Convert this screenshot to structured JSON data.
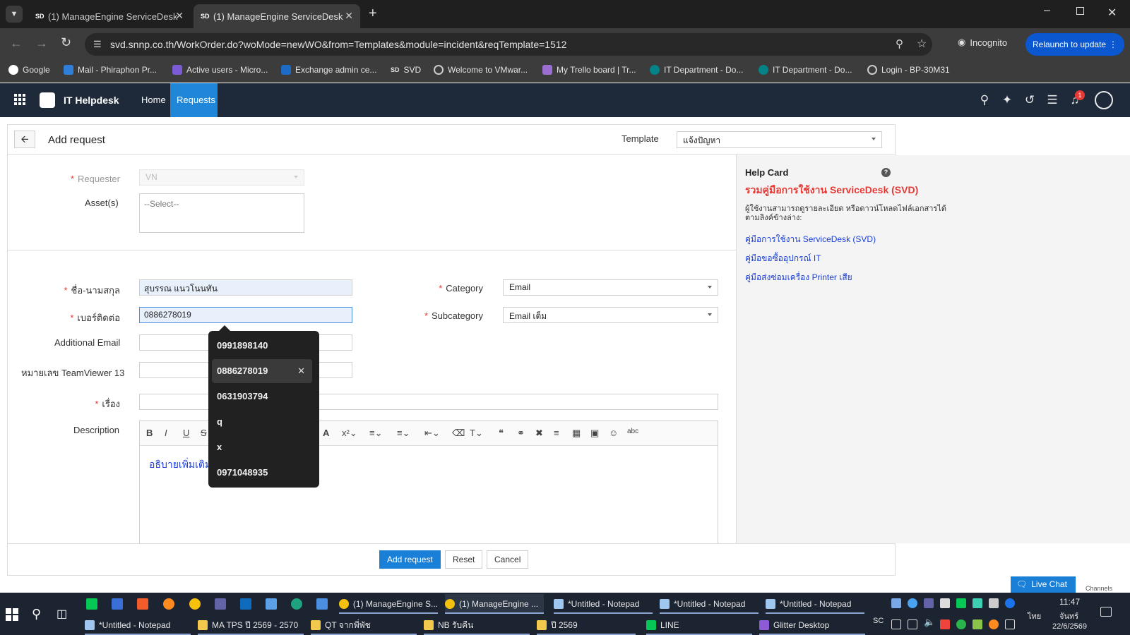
{
  "browser": {
    "tabs": [
      {
        "favicon": "SD",
        "title": "(1) ManageEngine ServiceDesk",
        "active": false
      },
      {
        "favicon": "SD",
        "title": "(1) ManageEngine ServiceDesk",
        "active": true
      }
    ],
    "url": "svd.snnp.co.th/WorkOrder.do?woMode=newWO&from=Templates&module=incident&reqTemplate=1512",
    "incognito_label": "Incognito",
    "relaunch_label": "Relaunch to update",
    "bookmarks": [
      "Google",
      "Mail - Phiraphon Pr...",
      "Active users - Micro...",
      "Exchange admin ce...",
      "SVD",
      "Welcome to VMwar...",
      "My Trello board | Tr...",
      "IT Department - Do...",
      "IT Department - Do...",
      "Login - BP-30M31"
    ]
  },
  "app": {
    "name": "IT Helpdesk",
    "nav": [
      "Home",
      "Requests"
    ],
    "notification_count": "1"
  },
  "form": {
    "title": "Add request",
    "template_label": "Template",
    "template_value": "แจ้งปัญหา",
    "requester_label": "Requester",
    "requester_value": "VN",
    "assets_label": "Asset(s)",
    "assets_placeholder": "--Select--",
    "name_label": "ชื่อ-นามสกุล",
    "name_value": "สุบรรณ  แนวโนนทัน",
    "phone_label": "เบอร์ติดต่อ",
    "phone_value": "0886278019",
    "add_email_label": "Additional Email",
    "teamviewer_label": "หมายเลข TeamViewer 13",
    "subject_label": "เรื่อง",
    "description_label": "Description",
    "description_value": "อธิบายเพิ่มเติม",
    "category_label": "Category",
    "category_value": "Email",
    "subcategory_label": "Subcategory",
    "subcategory_value": "Email เต็ม",
    "buttons": {
      "add": "Add request",
      "reset": "Reset",
      "cancel": "Cancel"
    }
  },
  "autocomplete": {
    "items": [
      "0991898140",
      "0886278019",
      "0631903794",
      "q",
      "x",
      "0971048935"
    ],
    "highlighted_index": 1
  },
  "help": {
    "title": "Help Card",
    "headline": "รวมคู่มือการใช้งาน  ServiceDesk (SVD)",
    "intro": "ผู้ใช้งานสามารถดูรายละเอียด หรือดาวน์โหลดไฟล์เอกสารได้ ตามลิงค์ข้างล่าง:",
    "links": [
      "คู่มือการใช้งาน ServiceDesk (SVD)",
      "คู่มือขอซื้ออุปกรณ์ IT",
      "คู่มือส่งซ่อมเครื่อง Printer เสีย"
    ]
  },
  "chat": {
    "live_chat": "Live Chat",
    "channels": "Channels"
  },
  "taskbar": {
    "row1": [
      "(1) ManageEngine S...",
      "(1) ManageEngine ...",
      "*Untitled - Notepad",
      "*Untitled - Notepad",
      "*Untitled - Notepad"
    ],
    "row2": [
      "*Untitled - Notepad",
      "MA TPS ปี 2569 - 2570",
      "QT จากพี่พัช",
      "NB รับคืน",
      "ปี 2569",
      "LINE",
      "Glitter Desktop"
    ],
    "tray_sc": "SC",
    "lang": "ไทย",
    "time": "11:47",
    "day": "จันทร์",
    "date": "22/6/2569"
  },
  "colors": {
    "app_header": "#1e2a3a",
    "nav_active": "#1f86d8",
    "primary_button": "#1a7fd6",
    "required": "#e53935",
    "help_headline": "#e53935",
    "link": "#1a3fd6"
  }
}
